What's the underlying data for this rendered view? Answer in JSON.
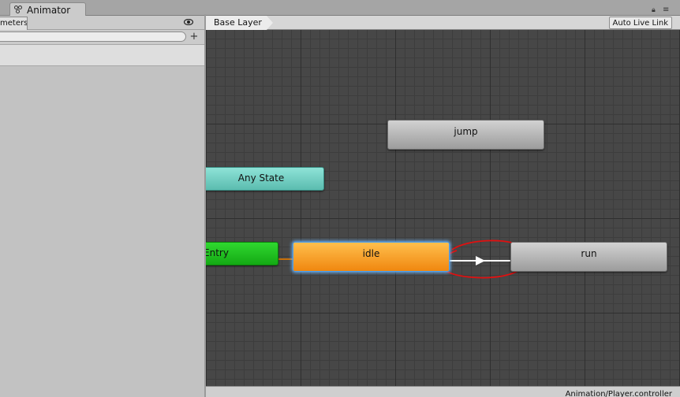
{
  "window": {
    "tab_label": "Animator"
  },
  "left_panel": {
    "tab_label": "meters",
    "search": {
      "value": "",
      "placeholder": ""
    },
    "add_label": "+"
  },
  "graph_header": {
    "breadcrumb": "Base Layer",
    "auto_live_link": "Auto Live Link"
  },
  "graph": {
    "states": {
      "jump": "jump",
      "any_state": "Any State",
      "entry": "Entry",
      "idle": "idle",
      "run": "run"
    },
    "colors": {
      "background": "#474747",
      "default_state": "#b3b3b3",
      "any_state": "#74cfc3",
      "entry": "#1fbf1f",
      "idle_selected": "#f5a12a",
      "selection_glow": "#6bb7ff",
      "transition": "#ffffff",
      "annotation_circle": "#e01010"
    }
  },
  "status_bar": {
    "path": "Animation/Player.controller"
  }
}
